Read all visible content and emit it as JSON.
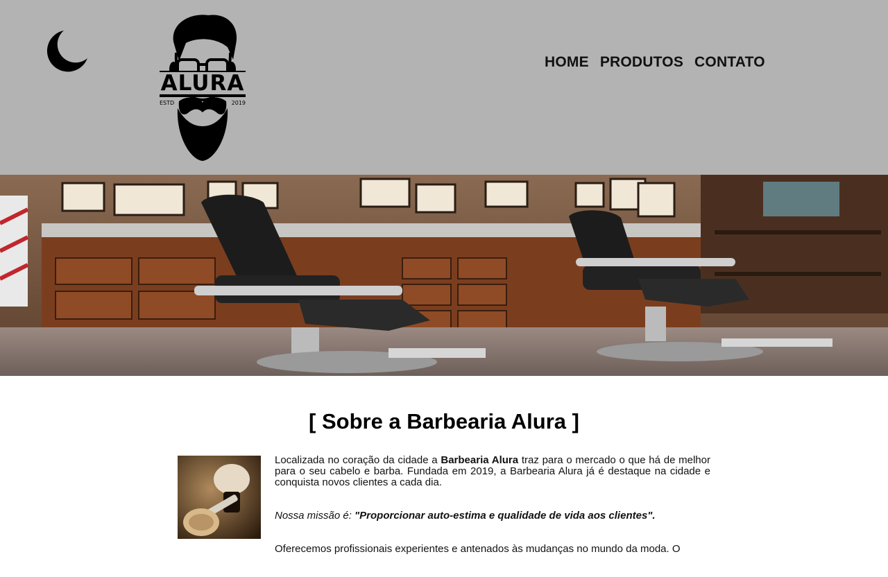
{
  "header": {
    "theme_toggle_icon": "moon-icon",
    "logo": {
      "icon": "bearded-man-logo",
      "brand": "ALURA",
      "left_text": "ESTD",
      "right_text": "2019"
    },
    "nav": [
      {
        "label": "HOME"
      },
      {
        "label": "PRODUTOS"
      },
      {
        "label": "CONTATO"
      }
    ]
  },
  "banner": {
    "icon": "barbershop-interior-photo"
  },
  "about": {
    "title": "[ Sobre a Barbearia Alura ]",
    "image_icon": "shaving-brush-razor-photo",
    "p1_before": "Localizada no coração da cidade a ",
    "p1_bold": "Barbearia Alura",
    "p1_after": " traz para o mercado o que há de melhor para o seu cabelo e barba. Fundada em 2019, a Barbearia Alura já é destaque na cidade e conquista novos clientes a cada dia.",
    "mission_label": "Nossa missão é: ",
    "mission_text": "\"Proporcionar auto-estima e qualidade de vida aos clientes\".",
    "p3": "Oferecemos profissionais experientes e antenados às mudanças no mundo da moda. O"
  },
  "colors": {
    "header_bg": "#b3b3b3",
    "page_bg": "#ffffff",
    "text": "#111111"
  }
}
